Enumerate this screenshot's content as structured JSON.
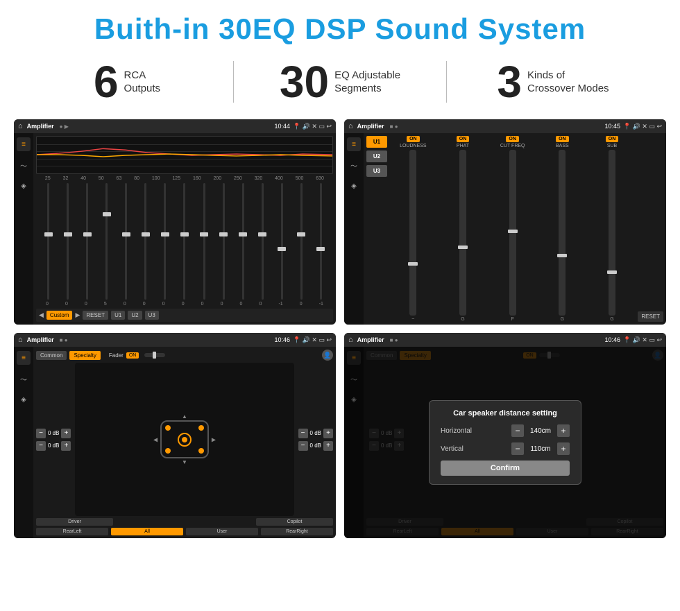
{
  "header": {
    "title": "Buith-in 30EQ DSP Sound System"
  },
  "stats": [
    {
      "number": "6",
      "text_line1": "RCA",
      "text_line2": "Outputs"
    },
    {
      "number": "30",
      "text_line1": "EQ Adjustable",
      "text_line2": "Segments"
    },
    {
      "number": "3",
      "text_line1": "Kinds of",
      "text_line2": "Crossover Modes"
    }
  ],
  "screens": [
    {
      "id": "eq-screen",
      "status_bar": {
        "app": "Amplifier",
        "indicators": "● ▶",
        "time": "10:44"
      },
      "eq_freq": [
        "25",
        "32",
        "40",
        "50",
        "63",
        "80",
        "100",
        "125",
        "160",
        "200",
        "250",
        "320",
        "400",
        "500",
        "630"
      ],
      "eq_vals": [
        "0",
        "0",
        "0",
        "5",
        "0",
        "0",
        "0",
        "0",
        "0",
        "0",
        "0",
        "0",
        "-1",
        "0",
        "-1"
      ],
      "eq_preset": "Custom",
      "btns": [
        "RESET",
        "U1",
        "U2",
        "U3"
      ]
    },
    {
      "id": "crossover-screen",
      "status_bar": {
        "app": "Amplifier",
        "indicators": "■ ●",
        "time": "10:45"
      },
      "presets": [
        "U1",
        "U2",
        "U3"
      ],
      "channels": [
        {
          "label": "LOUDNESS",
          "on": true
        },
        {
          "label": "PHAT",
          "on": true
        },
        {
          "label": "CUT FREQ",
          "on": true
        },
        {
          "label": "BASS",
          "on": true
        },
        {
          "label": "SUB",
          "on": true
        }
      ],
      "reset_btn": "RESET"
    },
    {
      "id": "fader-screen",
      "status_bar": {
        "app": "Amplifier",
        "indicators": "■ ●",
        "time": "10:46"
      },
      "tabs": [
        "Common",
        "Specialty"
      ],
      "active_tab": "Specialty",
      "fader_label": "Fader",
      "fader_on": "ON",
      "volumes": [
        {
          "val": "0 dB"
        },
        {
          "val": "0 dB"
        },
        {
          "val": "0 dB"
        },
        {
          "val": "0 dB"
        }
      ],
      "bottom_btns": [
        "Driver",
        "RearLeft",
        "All",
        "User",
        "RearRight",
        "Copilot"
      ]
    },
    {
      "id": "dialog-screen",
      "status_bar": {
        "app": "Amplifier",
        "indicators": "■ ●",
        "time": "10:46"
      },
      "tabs": [
        "Common",
        "Specialty"
      ],
      "active_tab": "Specialty",
      "dialog": {
        "title": "Car speaker distance setting",
        "fields": [
          {
            "label": "Horizontal",
            "value": "140cm"
          },
          {
            "label": "Vertical",
            "value": "110cm"
          }
        ],
        "confirm_btn": "Confirm"
      },
      "right_volumes": [
        {
          "val": "0 dB"
        },
        {
          "val": "0 dB"
        }
      ],
      "bottom_btns": [
        "Driver",
        "RearLeft",
        "All",
        "User",
        "RearRight",
        "Copilot"
      ]
    }
  ]
}
